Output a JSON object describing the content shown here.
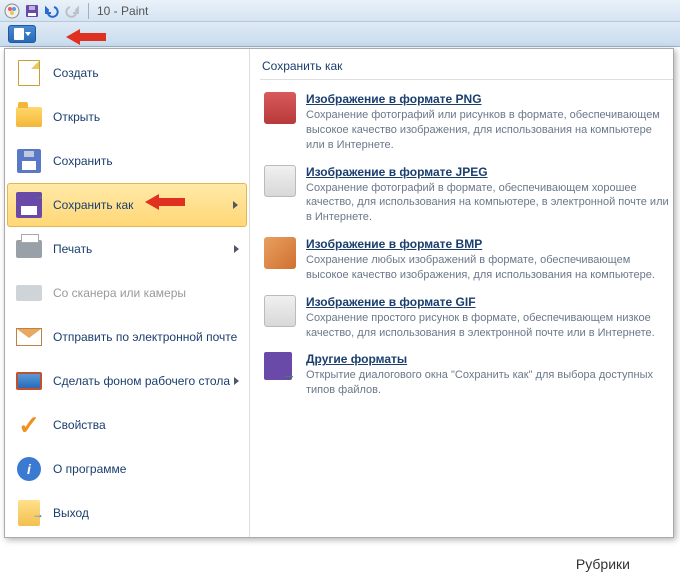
{
  "titlebar": {
    "title": "10 - Paint"
  },
  "menu": {
    "items": [
      {
        "label": "Создать",
        "icon": "page"
      },
      {
        "label": "Открыть",
        "icon": "folder"
      },
      {
        "label": "Сохранить",
        "icon": "floppy"
      },
      {
        "label": "Сохранить как",
        "icon": "floppy-arrow",
        "submenu": true,
        "highlighted": true
      },
      {
        "label": "Печать",
        "icon": "printer",
        "submenu": true
      },
      {
        "label": "Со сканера или камеры",
        "icon": "scanner",
        "disabled": true
      },
      {
        "label": "Отправить по электронной почте",
        "icon": "envelope"
      },
      {
        "label": "Сделать фоном рабочего стола",
        "icon": "desktop",
        "submenu": true
      },
      {
        "label": "Свойства",
        "icon": "check"
      },
      {
        "label": "О программе",
        "icon": "info"
      },
      {
        "label": "Выход",
        "icon": "exit"
      }
    ]
  },
  "submenu": {
    "title": "Сохранить как",
    "items": [
      {
        "title": "Изображение в формате PNG",
        "desc": "Сохранение фотографий или рисунков в формате, обеспечивающем высокое качество изображения, для использования на компьютере или в Интернете.",
        "icon": "png"
      },
      {
        "title": "Изображение в формате JPEG",
        "desc": "Сохранение фотографий в формате, обеспечивающем хорошее качество, для использования на компьютере, в электронной почте или в Интернете.",
        "icon": "jpeg"
      },
      {
        "title": "Изображение в формате BMP",
        "desc": "Сохранение любых изображений в формате, обеспечивающем высокое качество изображения, для использования на компьютере.",
        "icon": "bmp"
      },
      {
        "title": "Изображение в формате GIF",
        "desc": "Сохранение простого рисунок в формате, обеспечивающем низкое качество, для использования в электронной почте или в Интернете.",
        "icon": "gif"
      },
      {
        "title": "Другие форматы",
        "desc": "Открытие диалогового окна \"Сохранить как\" для выбора доступных типов файлов.",
        "icon": "other"
      }
    ]
  },
  "footer": {
    "text": "Рубрики"
  }
}
